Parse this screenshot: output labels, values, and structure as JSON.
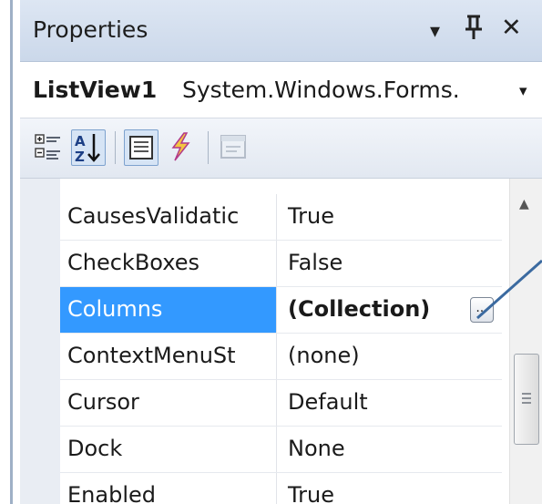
{
  "panel": {
    "title": "Properties",
    "buttons": {
      "dropdown": "▾",
      "pin": "ꟾ",
      "close": "✕"
    }
  },
  "object_selector": {
    "name": "ListView1",
    "type": "System.Windows.Forms.",
    "dropdown_glyph": "▾"
  },
  "toolbar": {
    "items": [
      {
        "icon": "categorized-icon",
        "active": false
      },
      {
        "icon": "alphabetical-icon",
        "active": true
      },
      {
        "icon": "properties-icon",
        "active": true
      },
      {
        "icon": "events-icon",
        "active": false
      },
      {
        "icon": "property-pages-icon",
        "active": false
      }
    ]
  },
  "grid": {
    "rows": [
      {
        "name": "CausesValidatic",
        "value": "True"
      },
      {
        "name": "CheckBoxes",
        "value": "False"
      },
      {
        "name": "Columns",
        "value": "(Collection)",
        "selected": true,
        "button_label": "..."
      },
      {
        "name": "ContextMenuSt",
        "value": "(none)"
      },
      {
        "name": "Cursor",
        "value": "Default"
      },
      {
        "name": "Dock",
        "value": "None"
      },
      {
        "name": "Enabled",
        "value": "True"
      }
    ]
  },
  "colors": {
    "selection": "#3399ff",
    "header_bg": "#cbd8ea",
    "gutter": "#e9edf3",
    "callout_line": "#3b6aa0"
  }
}
